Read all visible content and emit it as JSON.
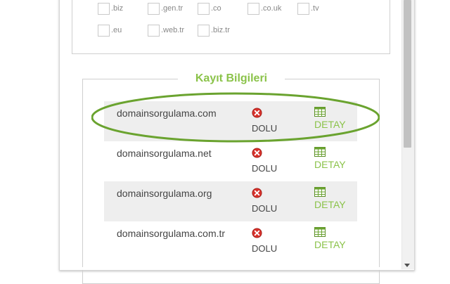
{
  "extensions": {
    "row1": [
      ".biz",
      ".gen.tr",
      ".co",
      ".co.uk",
      ".tv"
    ],
    "row2": [
      ".eu",
      ".web.tr",
      ".biz.tr"
    ]
  },
  "registration": {
    "title": "Kayıt Bilgileri",
    "rows": [
      {
        "domain": "domainsorgulama.com",
        "status": "DOLU",
        "detail": "DETAY"
      },
      {
        "domain": "domainsorgulama.net",
        "status": "DOLU",
        "detail": "DETAY"
      },
      {
        "domain": "domainsorgulama.org",
        "status": "DOLU",
        "detail": "DETAY"
      },
      {
        "domain": "domainsorgulama.com.tr",
        "status": "DOLU",
        "detail": "DETAY"
      }
    ]
  },
  "colors": {
    "accent": "#8bc34a",
    "highlight_ring": "#6aa32f",
    "error_icon": "#d9312b"
  },
  "icons": {
    "status": "red-x-circle-icon",
    "detail": "table-grid-icon",
    "scroll": "chevron-down-icon"
  }
}
